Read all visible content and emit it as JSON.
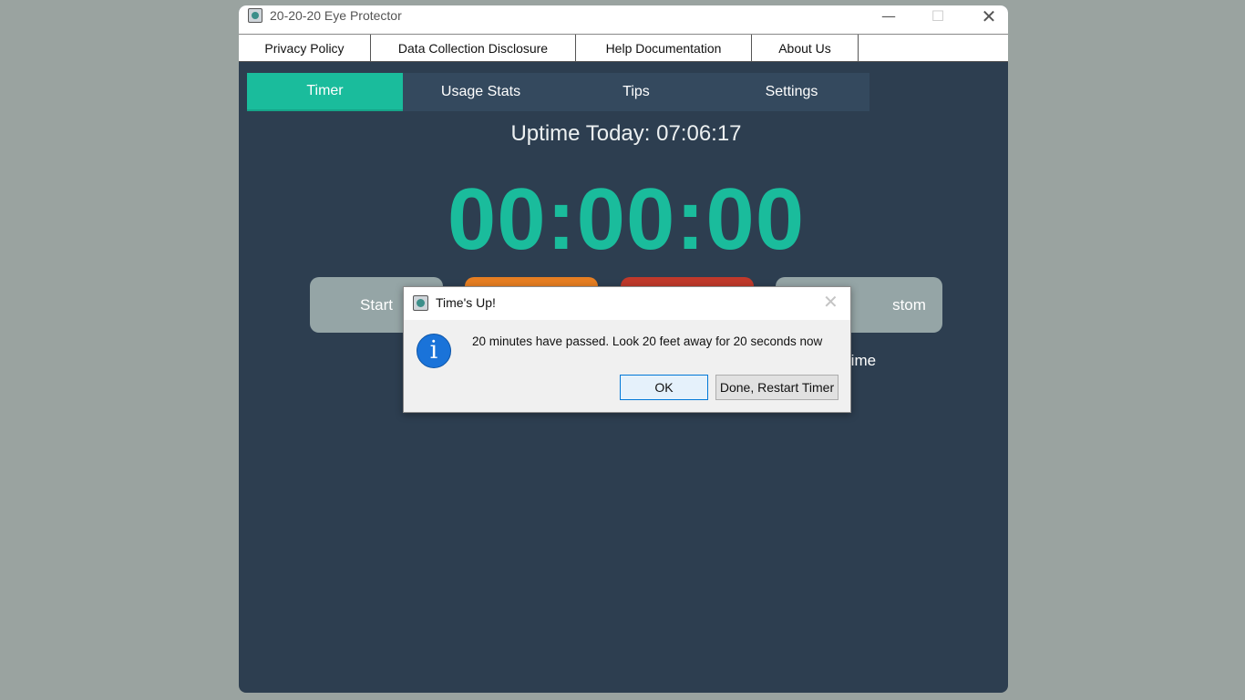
{
  "window": {
    "title": "20-20-20 Eye Protector",
    "minimize_glyph": "—",
    "maximize_glyph": "☐",
    "close_glyph": "✕"
  },
  "menu": {
    "items": [
      "Privacy Policy",
      "Data Collection Disclosure",
      "Help Documentation",
      "About Us"
    ]
  },
  "tabs": [
    "Timer",
    "Usage Stats",
    "Tips",
    "Settings"
  ],
  "active_tab": "Timer",
  "uptime": "Uptime Today: 07:06:17",
  "timer": "00:00:00",
  "controls": {
    "start": "Start",
    "pause": "",
    "stop": "",
    "custom_visible": "stom Time"
  },
  "dialog": {
    "title": "Time's Up!",
    "close_glyph": "✕",
    "message": "20 minutes have passed. Look 20 feet away for 20 seconds now",
    "info_glyph": "i",
    "ok": "OK",
    "restart": "Done, Restart Timer"
  },
  "colors": {
    "background": "#2d3e50",
    "accent": "#1abc9c",
    "tab_bar": "#34495e",
    "start_button": "#95a5a6",
    "pause_button": "#e67e22",
    "stop_button": "#c0392b",
    "info_blue": "#1a73d9"
  },
  "icons": {
    "app": "app-eye-icon",
    "dialog": "app-eye-icon",
    "info": "info-icon"
  }
}
